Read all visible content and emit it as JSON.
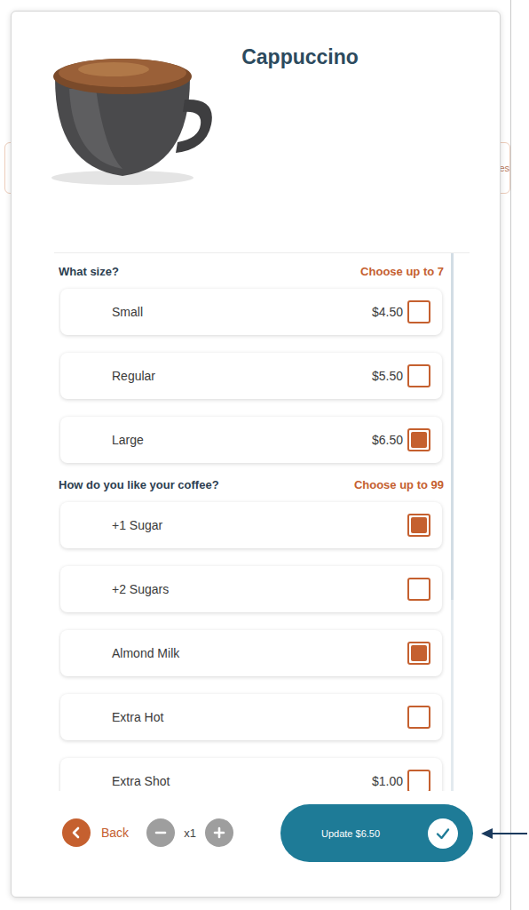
{
  "background": {
    "edge_text": "es"
  },
  "product": {
    "title": "Cappuccino"
  },
  "sections": [
    {
      "heading": "What size?",
      "limit": "Choose up to 7",
      "options": [
        {
          "label": "Small",
          "price": "$4.50",
          "checked": false
        },
        {
          "label": "Regular",
          "price": "$5.50",
          "checked": false
        },
        {
          "label": "Large",
          "price": "$6.50",
          "checked": true
        }
      ]
    },
    {
      "heading": "How do you like your coffee?",
      "limit": "Choose up to 99",
      "options": [
        {
          "label": "+1 Sugar",
          "checked": true
        },
        {
          "label": "+2 Sugars",
          "checked": false
        },
        {
          "label": "Almond Milk",
          "checked": true
        },
        {
          "label": "Extra Hot",
          "checked": false
        },
        {
          "label": "Extra Shot",
          "price": "$1.00",
          "checked": false
        }
      ]
    }
  ],
  "footer": {
    "back": "Back",
    "quantity": "x1",
    "update": "Update $6.50"
  }
}
